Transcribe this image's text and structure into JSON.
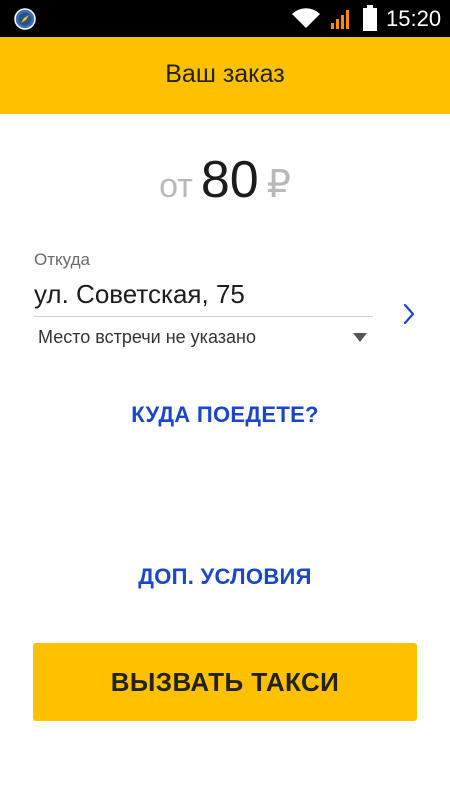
{
  "status_bar": {
    "time": "15:20",
    "app_icon": "compass-app-icon",
    "wifi_icon": "wifi-icon",
    "signal_icon": "signal-icon",
    "battery_icon": "battery-icon"
  },
  "header": {
    "title": "Ваш заказ",
    "background_color": "#ffc000"
  },
  "price": {
    "prefix": "от",
    "value": "80",
    "currency": "₽"
  },
  "from": {
    "label": "Откуда",
    "address": "ул. Советская, 75",
    "chevron_icon": "chevron-right-icon",
    "meeting_point": {
      "selected": "Место встречи не указано",
      "arrow_icon": "dropdown-arrow-icon"
    }
  },
  "links": {
    "where_to": "КУДА ПОЕДЕТЕ?",
    "extra_conditions": "ДОП. УСЛОВИЯ",
    "color": "#1a46c8"
  },
  "call_button": {
    "label": "ВЫЗВАТЬ ТАКСИ",
    "background_color": "#ffc000"
  }
}
